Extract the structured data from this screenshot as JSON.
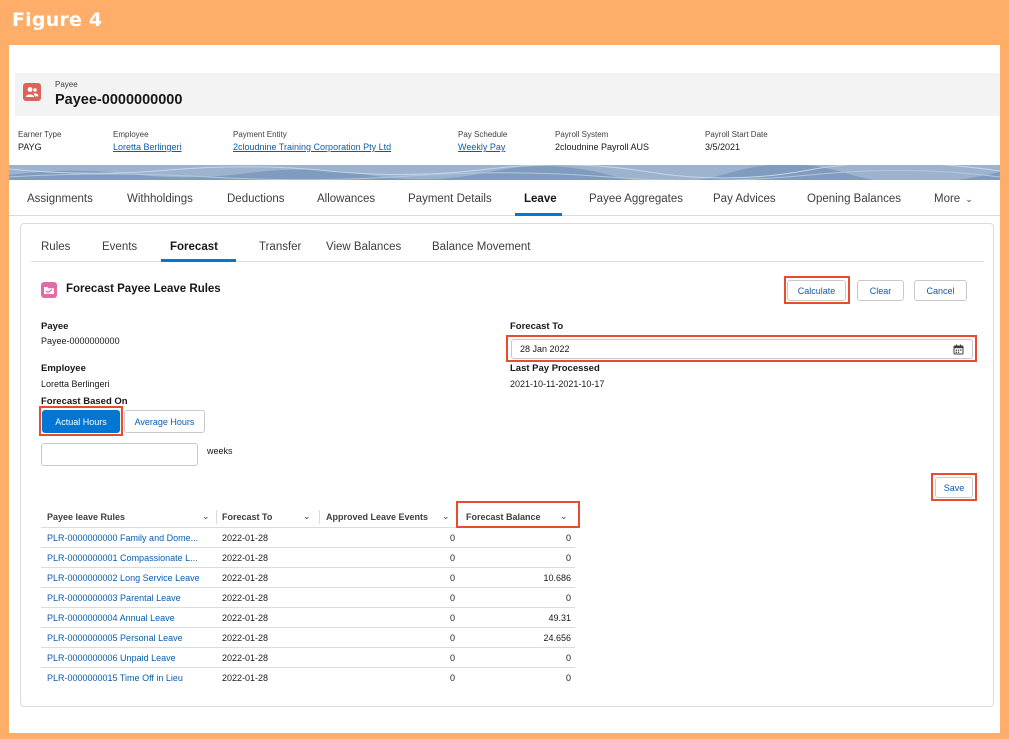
{
  "figure_title": "Figure 4",
  "record": {
    "type_label": "Payee",
    "name": "Payee-0000000000",
    "icon": "payee-icon",
    "icon_color": "#E0615A"
  },
  "highlights": [
    {
      "label": "Earner Type",
      "value": "PAYG",
      "link": false
    },
    {
      "label": "Employee",
      "value": "Loretta Berlingeri",
      "link": true
    },
    {
      "label": "Payment Entity",
      "value": "2cloudnine Training Corporation Pty Ltd",
      "link": true
    },
    {
      "label": "Pay Schedule",
      "value": "Weekly Pay",
      "link": true
    },
    {
      "label": "Payroll System",
      "value": "2cloudnine Payroll AUS",
      "link": false
    },
    {
      "label": "Payroll Start Date",
      "value": "3/5/2021",
      "link": false
    }
  ],
  "tabs": [
    "Assignments",
    "Withholdings",
    "Deductions",
    "Allowances",
    "Payment Details",
    "Leave",
    "Payee Aggregates",
    "Pay Advices",
    "Opening Balances",
    "More"
  ],
  "active_tab": "Leave",
  "subtabs": [
    "Rules",
    "Events",
    "Forecast",
    "Transfer",
    "View Balances",
    "Balance Movement"
  ],
  "active_subtab": "Forecast",
  "section": {
    "title": "Forecast Payee Leave Rules",
    "icon": "forecast-folder-icon",
    "icon_color": "#E06CA6"
  },
  "buttons": {
    "calculate": "Calculate",
    "clear": "Clear",
    "cancel": "Cancel",
    "save": "Save"
  },
  "form": {
    "payee_label": "Payee",
    "payee_value": "Payee-0000000000",
    "employee_label": "Employee",
    "employee_value": "Loretta Berlingeri",
    "forecast_based_on_label": "Forecast Based On",
    "actual_hours": "Actual Hours",
    "average_hours": "Average Hours",
    "selected_basis": "Actual Hours",
    "weeks_value": "",
    "weeks_label": "weeks",
    "forecast_to_label": "Forecast To",
    "forecast_to_value": "28 Jan 2022",
    "last_pay_label": "Last Pay Processed",
    "last_pay_value": "2021-10-11-2021-10-17"
  },
  "table": {
    "headers": [
      "Payee leave Rules",
      "Forecast To",
      "Approved Leave Events",
      "Forecast Balance"
    ],
    "rows": [
      {
        "rule": "PLR-0000000000 Family and Dome...",
        "forecast_to": "2022-01-28",
        "approved": "0",
        "balance": "0"
      },
      {
        "rule": "PLR-0000000001 Compassionate L...",
        "forecast_to": "2022-01-28",
        "approved": "0",
        "balance": "0"
      },
      {
        "rule": "PLR-0000000002 Long Service Leave",
        "forecast_to": "2022-01-28",
        "approved": "0",
        "balance": "10.686"
      },
      {
        "rule": "PLR-0000000003 Parental Leave",
        "forecast_to": "2022-01-28",
        "approved": "0",
        "balance": "0"
      },
      {
        "rule": "PLR-0000000004 Annual Leave",
        "forecast_to": "2022-01-28",
        "approved": "0",
        "balance": "49.31"
      },
      {
        "rule": "PLR-0000000005 Personal Leave",
        "forecast_to": "2022-01-28",
        "approved": "0",
        "balance": "24.656"
      },
      {
        "rule": "PLR-0000000006 Unpaid Leave",
        "forecast_to": "2022-01-28",
        "approved": "0",
        "balance": "0"
      },
      {
        "rule": "PLR-0000000015 Time Off in Lieu",
        "forecast_to": "2022-01-28",
        "approved": "0",
        "balance": "0"
      }
    ]
  },
  "colors": {
    "figure_background": "#FFAE6A",
    "highlight_box": "#E74C2F",
    "brand_blue": "#0176d3",
    "link_blue": "#0b5cab"
  }
}
